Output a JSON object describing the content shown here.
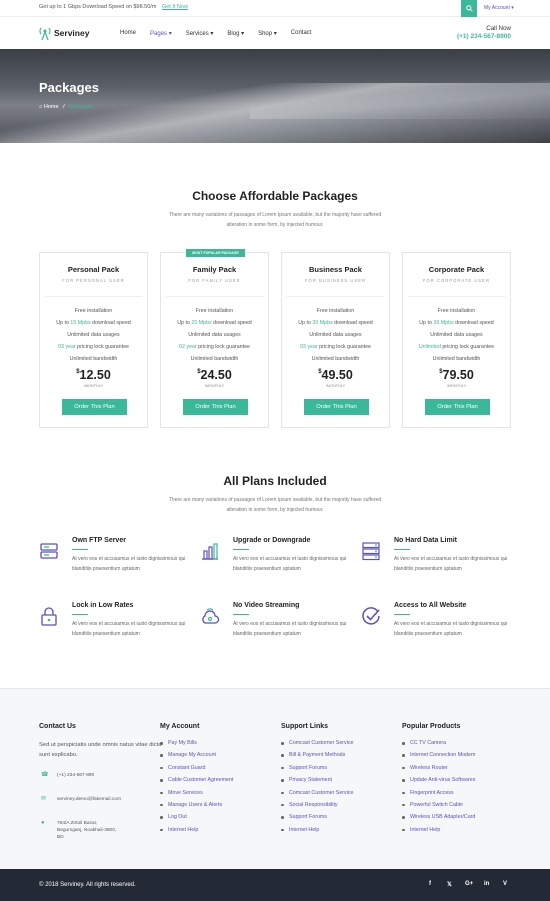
{
  "topbar": {
    "promo": "Get up to 1 Gbps Download Speed on $98.50/m",
    "promo_link": "Get It Now",
    "account": "My Account ▾"
  },
  "navbar": {
    "logo": "Serviney",
    "items": [
      "Home",
      "Pages ▾",
      "Services ▾",
      "Blog ▾",
      "Shop ▾",
      "Contact"
    ],
    "call_label": "Call Now",
    "call_number": "(+1) 234-567-8900"
  },
  "hero": {
    "title": "Packages",
    "crumb_home": "Home",
    "crumb_sep": "/",
    "crumb_current": "Packages"
  },
  "packages_section": {
    "title": "Choose Affordable Packages",
    "subtitle": "There are many variations of passages of Lorem Ipsum available, but the majority have suffered alteration in some form, by injected humour."
  },
  "packages": [
    {
      "badge": "",
      "name": "Personal Pack",
      "for": "FOR PERSONAL USER",
      "f1": "Free installation",
      "speed_pre": "Up to ",
      "speed": "15 Mpbs",
      "speed_post": " download speed",
      "f3": "Unlimited data usages",
      "lock": "03 year",
      "lock_post": " pricing lock guarantee",
      "f5": "Unlimited bandwidth",
      "currency": "$",
      "price": "12.50",
      "period": "/MONTHLY",
      "button": "Order This Plan"
    },
    {
      "badge": "MOST POPULAR PACKAGE",
      "name": "Family Pack",
      "for": "FOR FAMILY USER",
      "f1": "Free installation",
      "speed_pre": "Up to ",
      "speed": "25 Mpbs",
      "speed_post": " download speed",
      "f3": "Unlimited data usages",
      "lock": "02 year",
      "lock_post": " pricing lock guarantee",
      "f5": "Unlimited bandwidth",
      "currency": "$",
      "price": "24.50",
      "period": "/MONTHLY",
      "button": "Order This Plan"
    },
    {
      "badge": "",
      "name": "Business Pack",
      "for": "FOR BUSINESS USER",
      "f1": "Free installation",
      "speed_pre": "Up to ",
      "speed": "30 Mpbs",
      "speed_post": " download speed",
      "f3": "Unlimited data usages",
      "lock": "03 year",
      "lock_post": " pricing lock guarantee",
      "f5": "Unlimited bandwidth",
      "currency": "$",
      "price": "49.50",
      "period": "/MONTHLY",
      "button": "Order This Plan"
    },
    {
      "badge": "",
      "name": "Corporate Pack",
      "for": "FOR CORPORATE USER",
      "f1": "Free installation",
      "speed_pre": "Up to ",
      "speed": "39 Mpbs",
      "speed_post": " download speed",
      "f3": "Unlimited data usages",
      "lock": "Unlimited",
      "lock_post": " pricing lock guarantee",
      "f5": "Unlimited bandwidth",
      "currency": "$",
      "price": "79.50",
      "period": "/MONTHLY",
      "button": "Order This Plan"
    }
  ],
  "plans_section": {
    "title": "All Plans Included",
    "subtitle": "There are many variations of passages of Lorem Ipsum available, but the majority have suffered alteration in some form, by injected humour."
  },
  "features": [
    {
      "icon": "server-rack-icon",
      "title": "Own FTP Server",
      "desc": "At vero eos et accusamus et iusto dignissimous qui blanditiis praesentium uptatum"
    },
    {
      "icon": "bar-chart-icon",
      "title": "Upgrade or Downgrade",
      "desc": "At vero eos et accusamus et iusto dignissimous qui blanditiis praesentium uptatum"
    },
    {
      "icon": "database-icon",
      "title": "No Hard Data Limit",
      "desc": "At vero eos et accusamus et iusto dignissimous qui blanditiis praesentium uptatum"
    },
    {
      "icon": "lock-icon",
      "title": "Lock in Low Rates",
      "desc": "At vero eos et accusamus et iusto dignissimous qui blanditiis praesentium uptatum"
    },
    {
      "icon": "cloud-wifi-icon",
      "title": "No Video Streaming",
      "desc": "At vero eos et accusamus et iusto dignissimous qui blanditiis praesentium uptatum"
    },
    {
      "icon": "check-circle-icon",
      "title": "Access to All Website",
      "desc": "At vero eos et accusamus et iusto dignissimous qui blanditiis praesentium uptatum"
    }
  ],
  "footer": {
    "contact": {
      "title": "Contact Us",
      "about": "Sed ut perspiciatis unde omnis natus vitae dicta sunt explicabo.",
      "phone": "(+1) 234-567-890",
      "email": "serviney.demo@fakemail.com",
      "address": "784/A Zirtoil Bazar, Begumganj, Noakhali-3800, BD"
    },
    "account": {
      "title": "My Account",
      "links": [
        "Pay My Bills",
        "Manage My Account",
        "Constant Guard",
        "Cable Customer Agreement",
        "Move Services",
        "Manage Users & Alerts",
        "Log Out",
        "Internet Help"
      ]
    },
    "support": {
      "title": "Support Links",
      "links": [
        "Comcast Customer Service",
        "Bill & Payment Methods",
        "Support Forums",
        "Privacy Statement",
        "Comcast Customer Service",
        "Social Responsibility",
        "Support Forums",
        "Internet Help"
      ]
    },
    "products": {
      "title": "Popular Products",
      "links": [
        "CC TV Camera",
        "Internet Connection Modem",
        "Wireless Router",
        "Update Anti-virus Softwares",
        "Fingerprint Access",
        "Powerful Switch Cable",
        "Wireless USB Adapter/Card",
        "Internet Help"
      ]
    }
  },
  "bottom": {
    "copyright": "© 2018 Serviney. All rights reserved.",
    "social": [
      "f",
      "𝕏",
      "G+",
      "in",
      "V"
    ]
  },
  "colors": {
    "accent": "#3bb899",
    "link": "#5b4fc4",
    "dark": "#232a35"
  }
}
